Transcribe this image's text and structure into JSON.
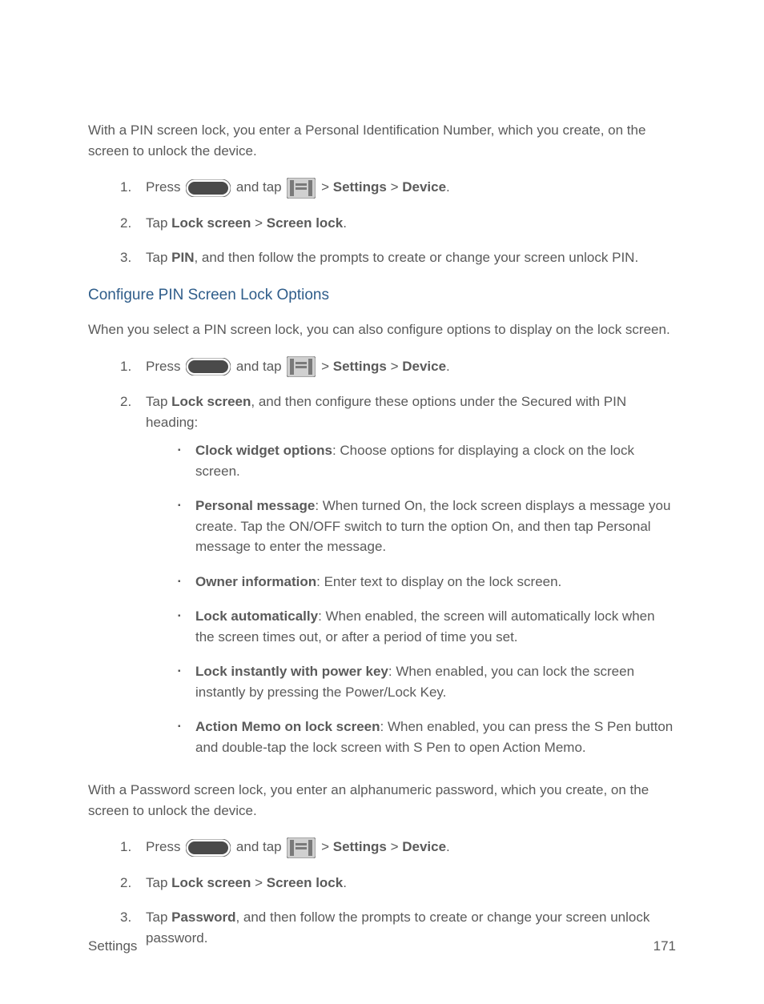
{
  "pin": {
    "intro": "With a PIN screen lock, you enter a Personal Identification Number, which you create, on the screen to unlock the device.",
    "step1_prefix": "Press ",
    "step1_mid": " and tap ",
    "step1_sep": " > ",
    "step1_settings_bold": "Settings",
    "step1_device_bold": "Device",
    "step1_suffix": ".",
    "step2_prefix": "Tap ",
    "step2_bold1": "Lock screen",
    "step2_sep": " > ",
    "step2_bold2": "Screen lock",
    "step2_suffix": ".",
    "step3_prefix": "Tap ",
    "step3_bold": "PIN",
    "step3_suffix": ", and then follow the prompts to create or change your screen unlock PIN."
  },
  "pinOptions": {
    "heading": "Configure PIN Screen Lock Options",
    "intro": "When you select a PIN screen lock, you can also configure options to display on the lock screen.",
    "step2_prefix": "Tap ",
    "step2_bold": "Lock screen",
    "step2_suffix": ", and then configure these options under the Secured with PIN heading:",
    "bullets": [
      {
        "bold": "Clock widget options",
        "text": ": Choose options for displaying a clock on the lock screen."
      },
      {
        "bold": "Personal message",
        "text": ": When turned On, the lock screen displays a message you create. Tap the ON/OFF switch to turn the option On, and then tap Personal message to enter the message."
      },
      {
        "bold": "Owner information",
        "text": ": Enter text to display on the lock screen."
      },
      {
        "bold": "Lock automatically",
        "text": ": When enabled, the screen will automatically lock when the screen times out, or after a period of time you set."
      },
      {
        "bold": "Lock instantly with power key",
        "text": ": When enabled, you can lock the screen instantly by pressing the Power/Lock Key."
      },
      {
        "bold": "Action Memo on lock screen",
        "text": ": When enabled, you can press the S Pen button and double-tap the lock screen with S Pen to open Action Memo."
      }
    ]
  },
  "password": {
    "intro": "With a Password screen lock, you enter an alphanumeric password, which you create, on the screen to unlock the device.",
    "step3_prefix": "Tap ",
    "step3_bold": "Password",
    "step3_suffix": ", and then follow the prompts to create or change your screen unlock password."
  },
  "footer": {
    "left": "Settings",
    "right": "171"
  }
}
